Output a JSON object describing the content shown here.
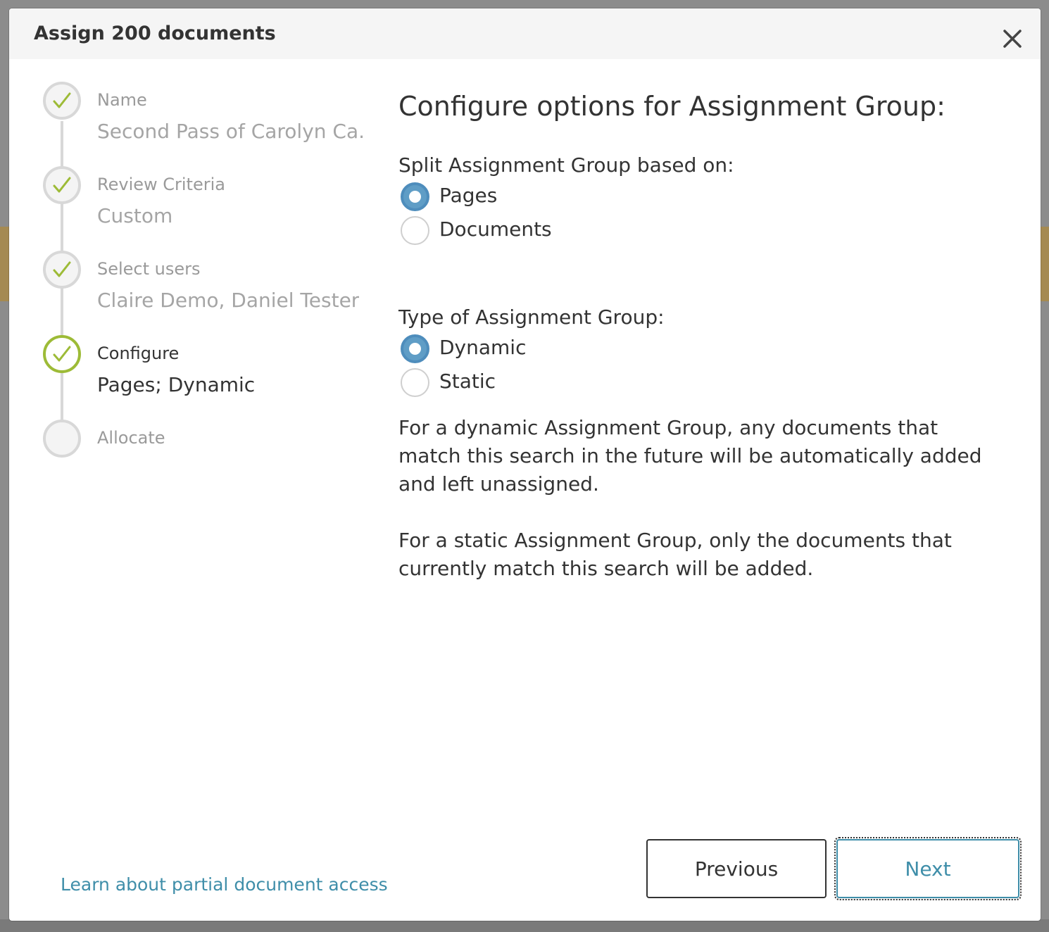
{
  "dialog": {
    "title": "Assign 200 documents"
  },
  "steps": [
    {
      "label": "Name",
      "value": "Second Pass of Carolyn Ca...",
      "status": "complete"
    },
    {
      "label": "Review Criteria",
      "value": "Custom",
      "status": "complete"
    },
    {
      "label": "Select users",
      "value": "Claire Demo, Daniel Tester",
      "status": "complete"
    },
    {
      "label": "Configure",
      "value": "Pages; Dynamic",
      "status": "active"
    },
    {
      "label": "Allocate",
      "value": "",
      "status": "pending"
    }
  ],
  "main": {
    "heading": "Configure options for Assignment Group:",
    "split": {
      "label": "Split Assignment Group based on:",
      "options": [
        "Pages",
        "Documents"
      ],
      "selected": "Pages"
    },
    "type": {
      "label": "Type of Assignment Group:",
      "options": [
        "Dynamic",
        "Static"
      ],
      "selected": "Dynamic"
    },
    "dynamic_description": "For a dynamic Assignment Group, any documents that match this search in the future will be automatically added and left unassigned.",
    "static_description": "For a static Assignment Group, only the documents that currently match this search will be added."
  },
  "footer": {
    "learn_link": "Learn about partial document access",
    "previous_label": "Previous",
    "next_label": "Next"
  },
  "colors": {
    "check_green": "#9dbb37",
    "radio_blue": "#5f9dc6",
    "link_teal": "#3f8ea9"
  }
}
